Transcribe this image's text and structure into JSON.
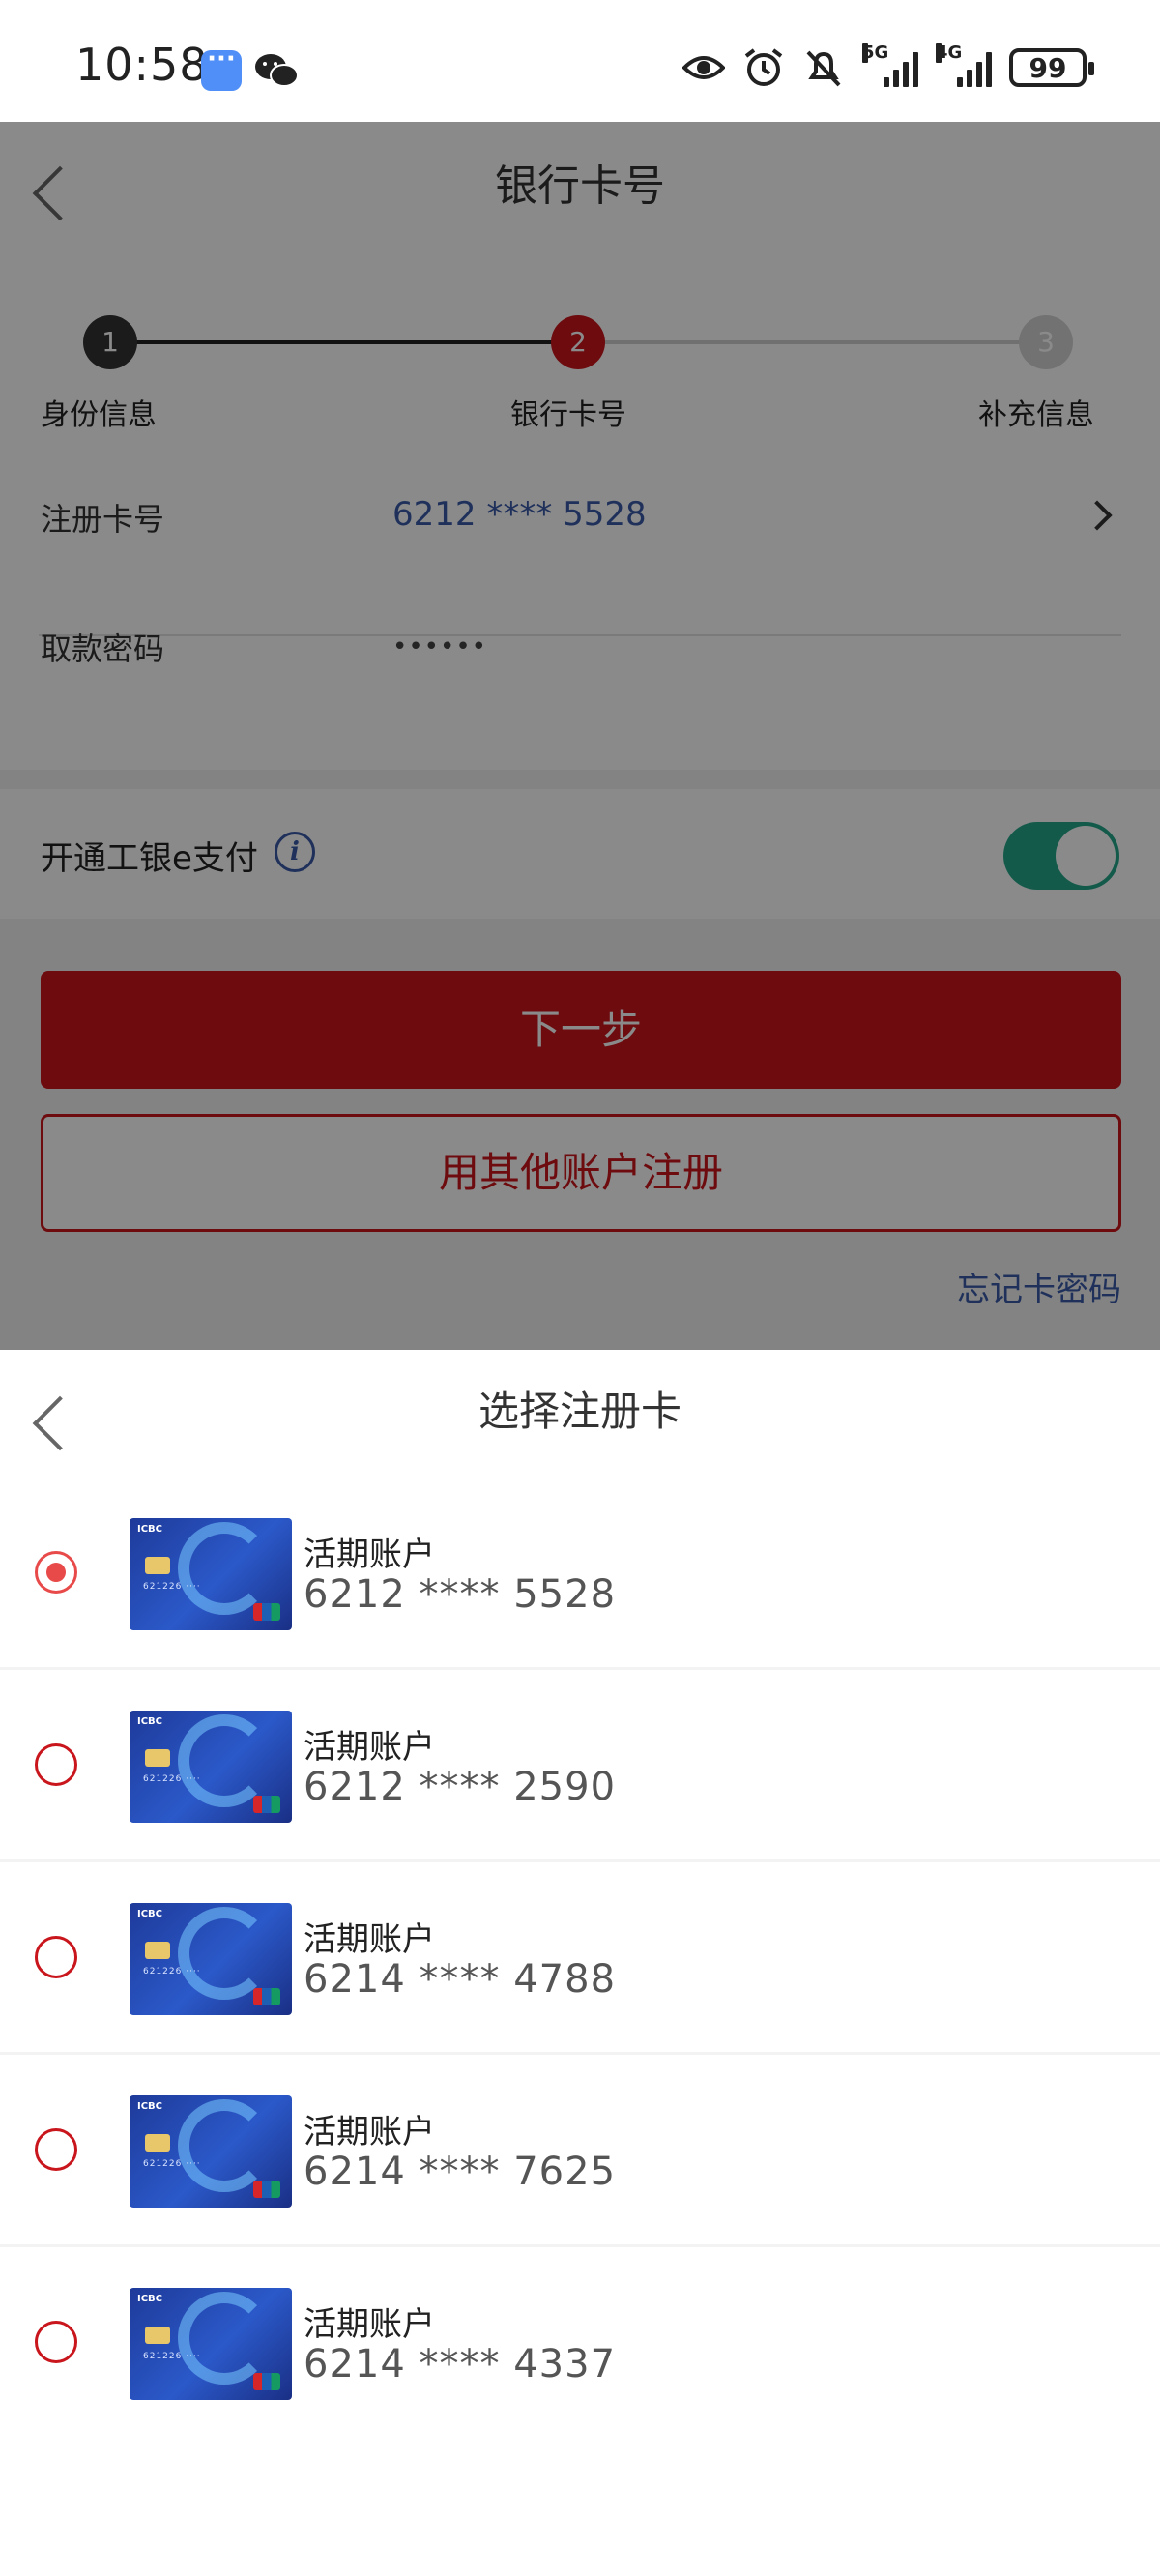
{
  "status_bar": {
    "time": "10:58",
    "network_1": "5G",
    "network_2": "4G",
    "battery": "99"
  },
  "background_page": {
    "title": "银行卡号",
    "steps": [
      {
        "number": "1",
        "label": "身份信息"
      },
      {
        "number": "2",
        "label": "银行卡号"
      },
      {
        "number": "3",
        "label": "补充信息"
      }
    ],
    "form": {
      "card_label": "注册卡号",
      "card_value": "6212 **** 5528",
      "pin_label": "取款密码",
      "pin_value": "••••••"
    },
    "epay": {
      "label": "开通工银e支付",
      "info_icon": "i",
      "enabled": true
    },
    "next_button": "下一步",
    "other_account_button": "用其他账户注册",
    "forgot_link": "忘记卡密码"
  },
  "sheet": {
    "title": "选择注册卡",
    "cards": [
      {
        "type": "活期账户",
        "number": "6212 **** 5528",
        "selected": true
      },
      {
        "type": "活期账户",
        "number": "6212 **** 2590",
        "selected": false
      },
      {
        "type": "活期账户",
        "number": "6214 **** 4788",
        "selected": false
      },
      {
        "type": "活期账户",
        "number": "6214 **** 7625",
        "selected": false
      },
      {
        "type": "活期账户",
        "number": "6214 **** 4337",
        "selected": false
      }
    ]
  },
  "colors": {
    "accent_red": "#c9161d",
    "link_blue": "#3a5ba8",
    "toggle_on": "#26a78b"
  }
}
